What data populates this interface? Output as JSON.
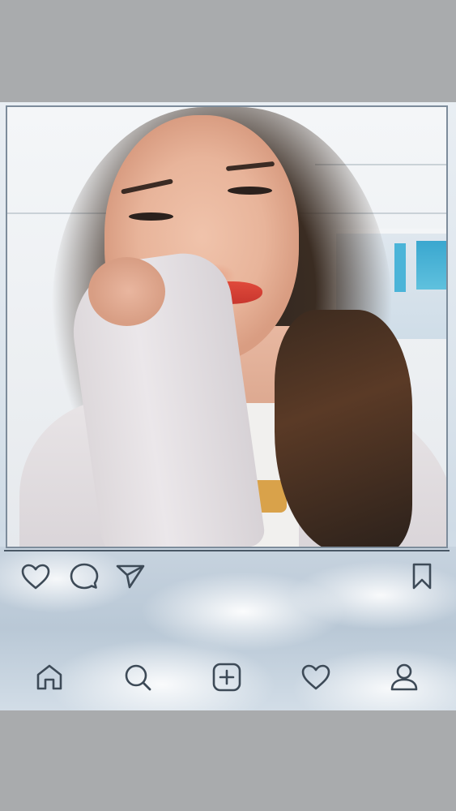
{
  "post": {
    "photo": {
      "alt": "",
      "caption": ""
    },
    "actions": [
      {
        "icon": "heart-icon"
      },
      {
        "icon": "comment-icon"
      },
      {
        "icon": "share-icon"
      },
      {
        "icon": "bookmark-icon"
      }
    ]
  },
  "bottom_nav": {
    "items": [
      {
        "icon": "home-icon"
      },
      {
        "icon": "search-icon"
      },
      {
        "icon": "add-post-icon"
      },
      {
        "icon": "activity-heart-icon"
      },
      {
        "icon": "profile-icon"
      }
    ]
  },
  "colors": {
    "background": "#a9abad",
    "icon_stroke": "#3d4a57",
    "photo_border": "#7d8c9b",
    "sky": "#c7d3df"
  }
}
